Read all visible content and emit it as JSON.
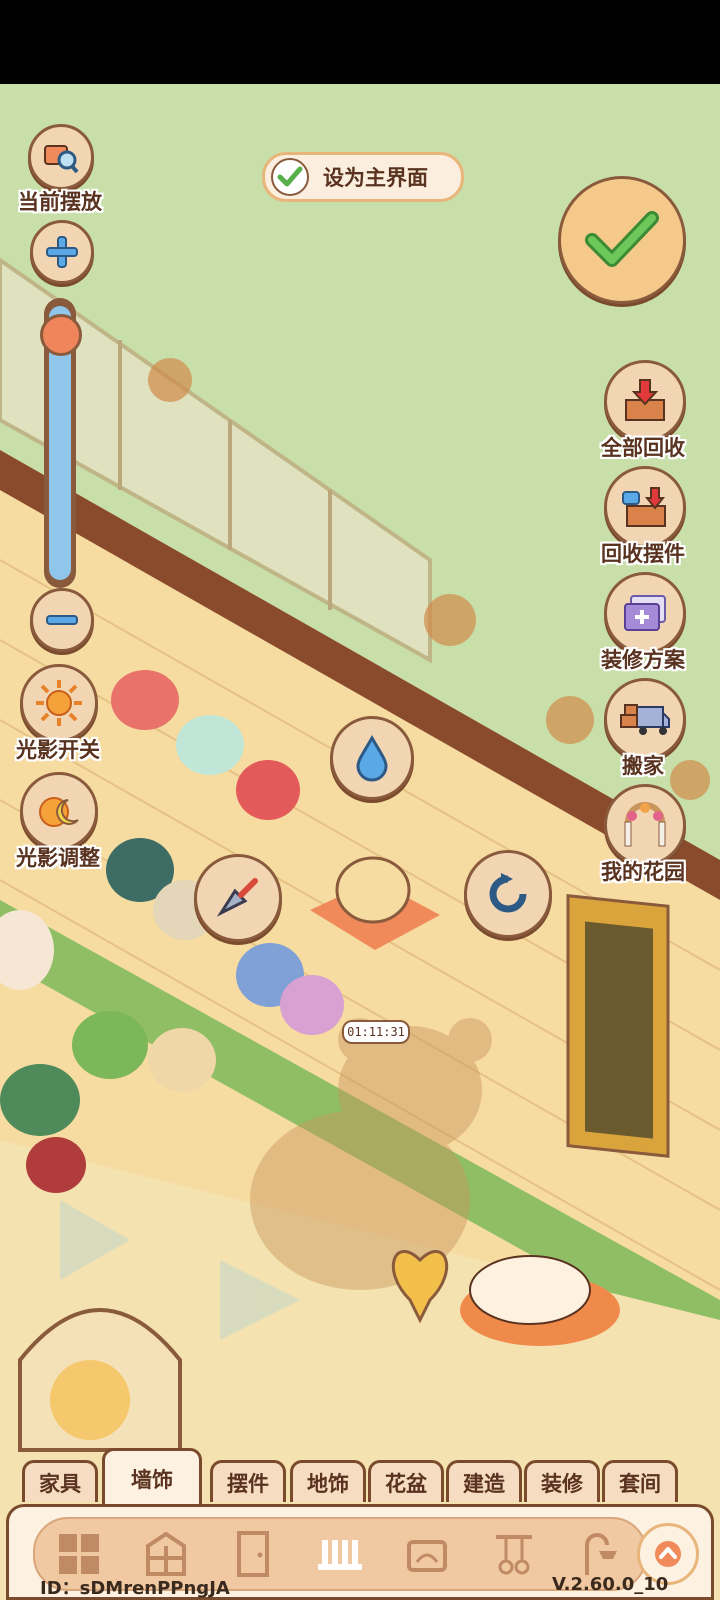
{
  "top_bar": {
    "set_main_label": "设为主界面"
  },
  "left_tools": {
    "current_place_label": "当前摆放",
    "light_toggle_label": "光影开关",
    "light_adjust_label": "光影调整"
  },
  "right_tools": {
    "recycle_all_label": "全部回收",
    "recycle_items_label": "回收摆件",
    "decor_plan_label": "装修方案",
    "move_house_label": "搬家",
    "my_garden_label": "我的花园"
  },
  "scene": {
    "timer_text": "01:11:31"
  },
  "tabs": [
    {
      "label": "家具"
    },
    {
      "label": "墙饰"
    },
    {
      "label": "摆件"
    },
    {
      "label": "地饰"
    },
    {
      "label": "花盆"
    },
    {
      "label": "建造"
    },
    {
      "label": "装修"
    },
    {
      "label": "套间"
    }
  ],
  "active_tab": "墙饰",
  "footer": {
    "id_text": "ID：sDMrenPPngJA",
    "version_text": "V.2.60.0_10"
  },
  "colors": {
    "sky": "#c8dfaa",
    "floor": "#f7dca2",
    "wood": "#8a5a3c",
    "accent_green": "#58b04a"
  }
}
